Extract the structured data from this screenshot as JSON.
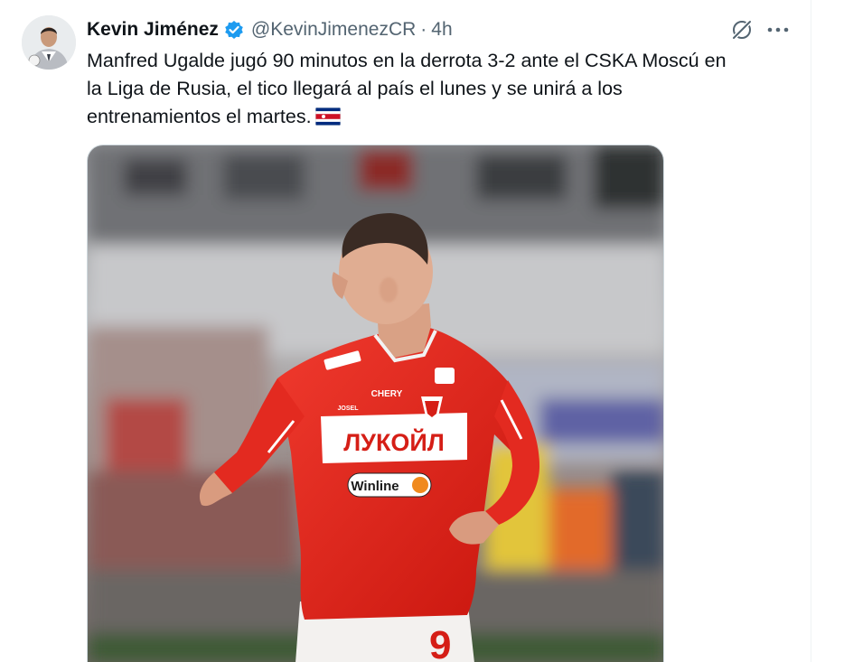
{
  "author": {
    "name": "Kevin Jiménez",
    "handle": "@KevinJimenezCR",
    "time": "4h"
  },
  "tweet": {
    "lines": [
      "Manfred Ugalde jugó 90 minutos en la derrota 3-2 ante el CSKA Moscú en",
      "la Liga de Rusia, el tico llegará al país el lunes y se unirá a los",
      "entrenamientos el martes."
    ]
  },
  "media": {
    "jersey_text": {
      "sponsor": "ЛУКОЙЛ",
      "betting": "Winline",
      "brand": "CHERY",
      "kit": "JOSEL",
      "number": "9"
    }
  },
  "colors": {
    "verified": "#1d9bf0",
    "secondary_text": "#536471",
    "jersey_red": "#e2231a"
  },
  "icons": {
    "verified": "verified-badge-icon",
    "grok": "grok-icon",
    "more": "more-options-icon",
    "flag": "costa-rica-flag-icon"
  }
}
